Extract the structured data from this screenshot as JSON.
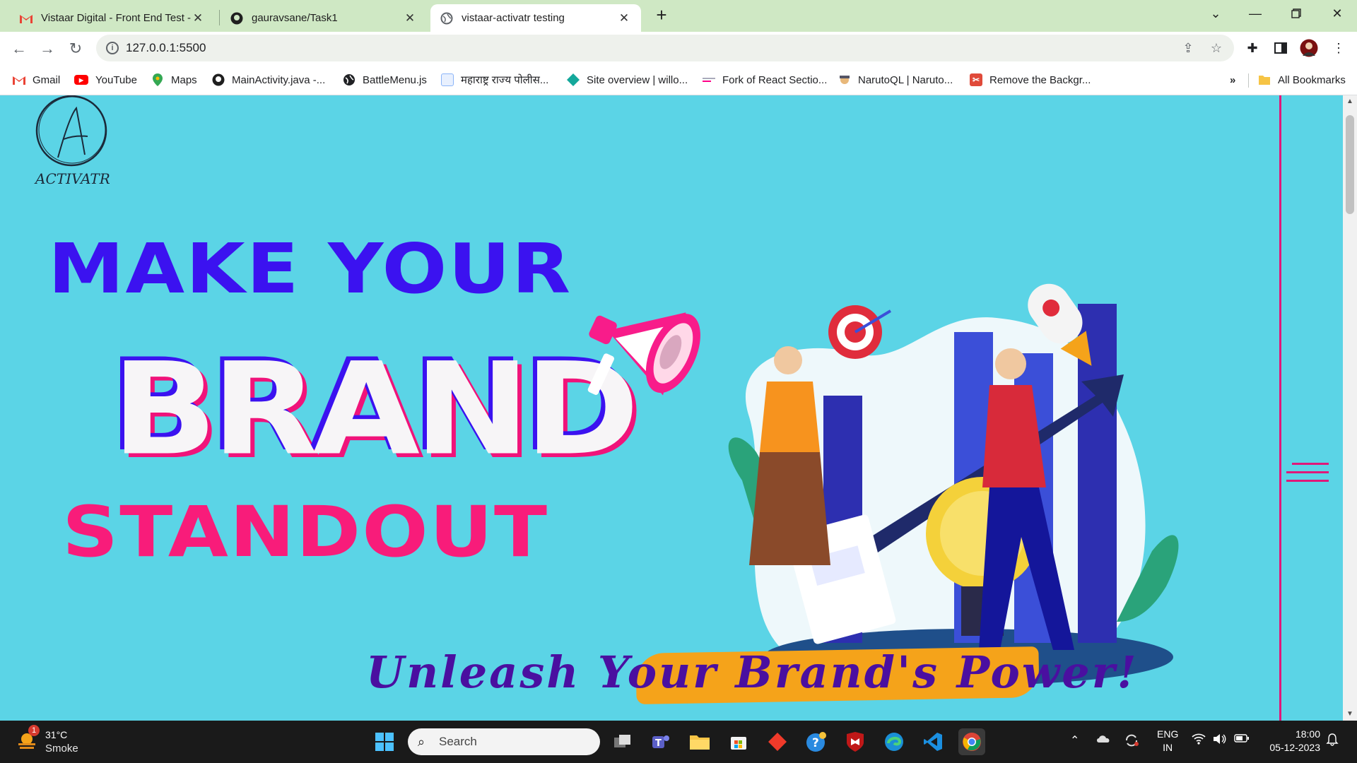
{
  "browser": {
    "tabs": [
      {
        "title": "Vistaar Digital - Front End Test -",
        "icon": "gmail-icon",
        "active": false
      },
      {
        "title": "gauravsane/Task1",
        "icon": "github-icon",
        "active": false
      },
      {
        "title": "vistaar-activatr testing",
        "icon": "globe-icon",
        "active": true
      }
    ],
    "url": "127.0.0.1:5500",
    "bookmarks": [
      {
        "label": "Gmail",
        "icon": "gmail-icon",
        "color": "#ea4335"
      },
      {
        "label": "YouTube",
        "icon": "youtube-icon",
        "color": "#ff0000"
      },
      {
        "label": "Maps",
        "icon": "maps-icon",
        "color": "#34a853"
      },
      {
        "label": "MainActivity.java -...",
        "icon": "github-icon",
        "color": "#000000"
      },
      {
        "label": "BattleMenu.js",
        "icon": "globe-icon",
        "color": "#000000"
      },
      {
        "label": "महाराष्ट्र राज्य पोलीस...",
        "icon": "document-icon",
        "color": "#8ab4f8"
      },
      {
        "label": "Site overview | willo...",
        "icon": "netlify-icon",
        "color": "#14a89b"
      },
      {
        "label": "Fork of React Sectio...",
        "icon": "codesandbox-icon",
        "color": "#5f6368"
      },
      {
        "label": "NarutoQL | Naruto...",
        "icon": "naruto-icon",
        "color": "#a0743a"
      },
      {
        "label": "Remove the Backgr...",
        "icon": "removebg-icon",
        "color": "#e04a3a"
      }
    ],
    "more_bookmarks": "»",
    "all_bookmarks": "All Bookmarks"
  },
  "page": {
    "logo_text": "ACTIVATR",
    "logo_letter": "A",
    "headline_1": "MAKE YOUR",
    "headline_2": "BRAND",
    "headline_3": "STANDOUT",
    "tagline": "Unleash Your Brand's Power!",
    "colors": {
      "background": "#5bd4e6",
      "blue": "#3b12f0",
      "pink": "#f81c7a",
      "tagline": "#4a0fa0",
      "brush": "#f5a31a"
    }
  },
  "taskbar": {
    "weather_temp": "31°C",
    "weather_condition": "Smoke",
    "weather_badge": "1",
    "search_label": "Search",
    "lang_1": "ENG",
    "lang_2": "IN",
    "time": "18:00",
    "date": "05-12-2023"
  }
}
